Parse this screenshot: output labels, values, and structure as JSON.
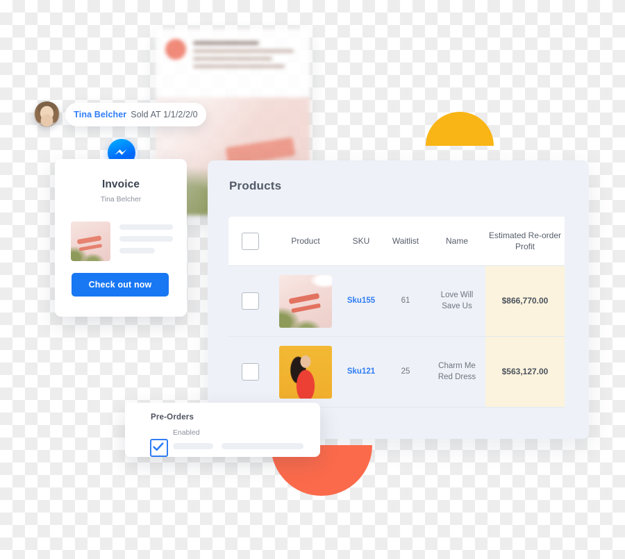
{
  "colors": {
    "accent_blue": "#1877F2",
    "link_blue": "#2F7DF6",
    "panel_bg": "#EEF1F7",
    "highlight_cream": "#FBF3DD",
    "decor_yellow": "#F9B515",
    "decor_orange": "#FB6A4B",
    "text_dark": "#4B525E",
    "text_muted": "#8B919C"
  },
  "notification": {
    "avatar": "user-avatar",
    "name": "Tina Belcher",
    "meta": "Sold AT 1/1/2/2/0"
  },
  "invoice_card": {
    "messenger_icon": "facebook-messenger-icon",
    "title": "Invoice",
    "customer": "Tina Belcher",
    "product_thumbnail": "love-will-save-us-shirt-thumbnail",
    "checkout_button": "Check out now"
  },
  "products_panel": {
    "title": "Products",
    "table": {
      "select_all_checkbox": "unchecked",
      "columns": [
        {
          "key": "select",
          "label": ""
        },
        {
          "key": "product",
          "label": "Product"
        },
        {
          "key": "sku",
          "label": "SKU"
        },
        {
          "key": "waitlist",
          "label": "Waitlist"
        },
        {
          "key": "name",
          "label": "Name"
        },
        {
          "key": "profit",
          "label": "Estimated Re-order Profit"
        }
      ],
      "rows": [
        {
          "selected": false,
          "thumbnail": "love-will-save-us-shirt-thumbnail",
          "sku": "Sku155",
          "waitlist": "61",
          "name_line1": "Love Will",
          "name_line2": "Save Us",
          "profit": "$866,770.00"
        },
        {
          "selected": false,
          "thumbnail": "charm-me-red-dress-thumbnail",
          "sku": "Sku121",
          "waitlist": "25",
          "name_line1": "Charm Me",
          "name_line2": "Red Dress",
          "profit": "$563,127.00"
        }
      ]
    }
  },
  "preorders_card": {
    "title": "Pre-Orders",
    "enabled_label": "Enabled",
    "enabled": true
  },
  "decorations": {
    "yellow_half_disc": "yellow-half-circle",
    "orange_half_disc": "orange-half-circle",
    "background_post_card": "blurred-social-post-card"
  }
}
